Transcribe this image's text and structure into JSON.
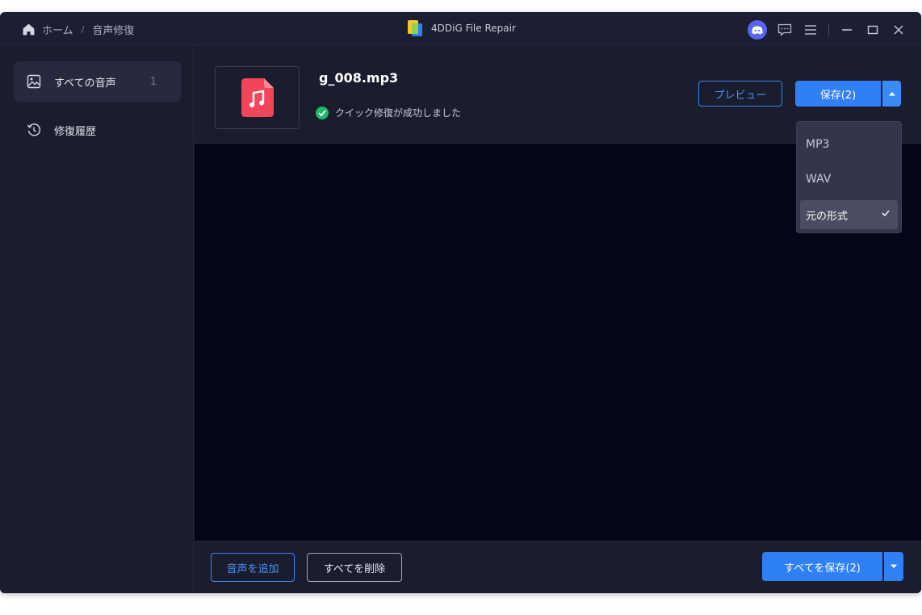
{
  "titlebar": {
    "breadcrumb": [
      "ホーム",
      "音声修復"
    ],
    "separator": "/",
    "app_title": "4DDiG File Repair",
    "icons": [
      "home-icon",
      "discord-icon",
      "feedback-icon",
      "menu-icon",
      "minimize-icon",
      "maximize-icon",
      "close-icon"
    ]
  },
  "sidebar": {
    "items": [
      {
        "label": "すべての音声",
        "count": "1",
        "icon": "image-icon",
        "active": true
      },
      {
        "label": "修復履歴",
        "icon": "history-icon",
        "active": false
      }
    ]
  },
  "file": {
    "name": "g_008.mp3",
    "status": "クイック修復が成功しました",
    "icon": "music-file-icon"
  },
  "actions": {
    "preview_label": "プレビュー",
    "save_label": "保存(2)"
  },
  "dropdown": {
    "options": [
      "MP3",
      "WAV",
      "元の形式"
    ],
    "selected": "元の形式"
  },
  "bottom": {
    "add_label": "音声を追加",
    "clear_label": "すべてを削除",
    "save_all_label": "すべてを保存(2)"
  },
  "colors": {
    "accent": "#2f7ff5",
    "success": "#1fb96a",
    "file_icon": "#f2455a",
    "background": "#050718",
    "panel": "#1a1d2e"
  }
}
